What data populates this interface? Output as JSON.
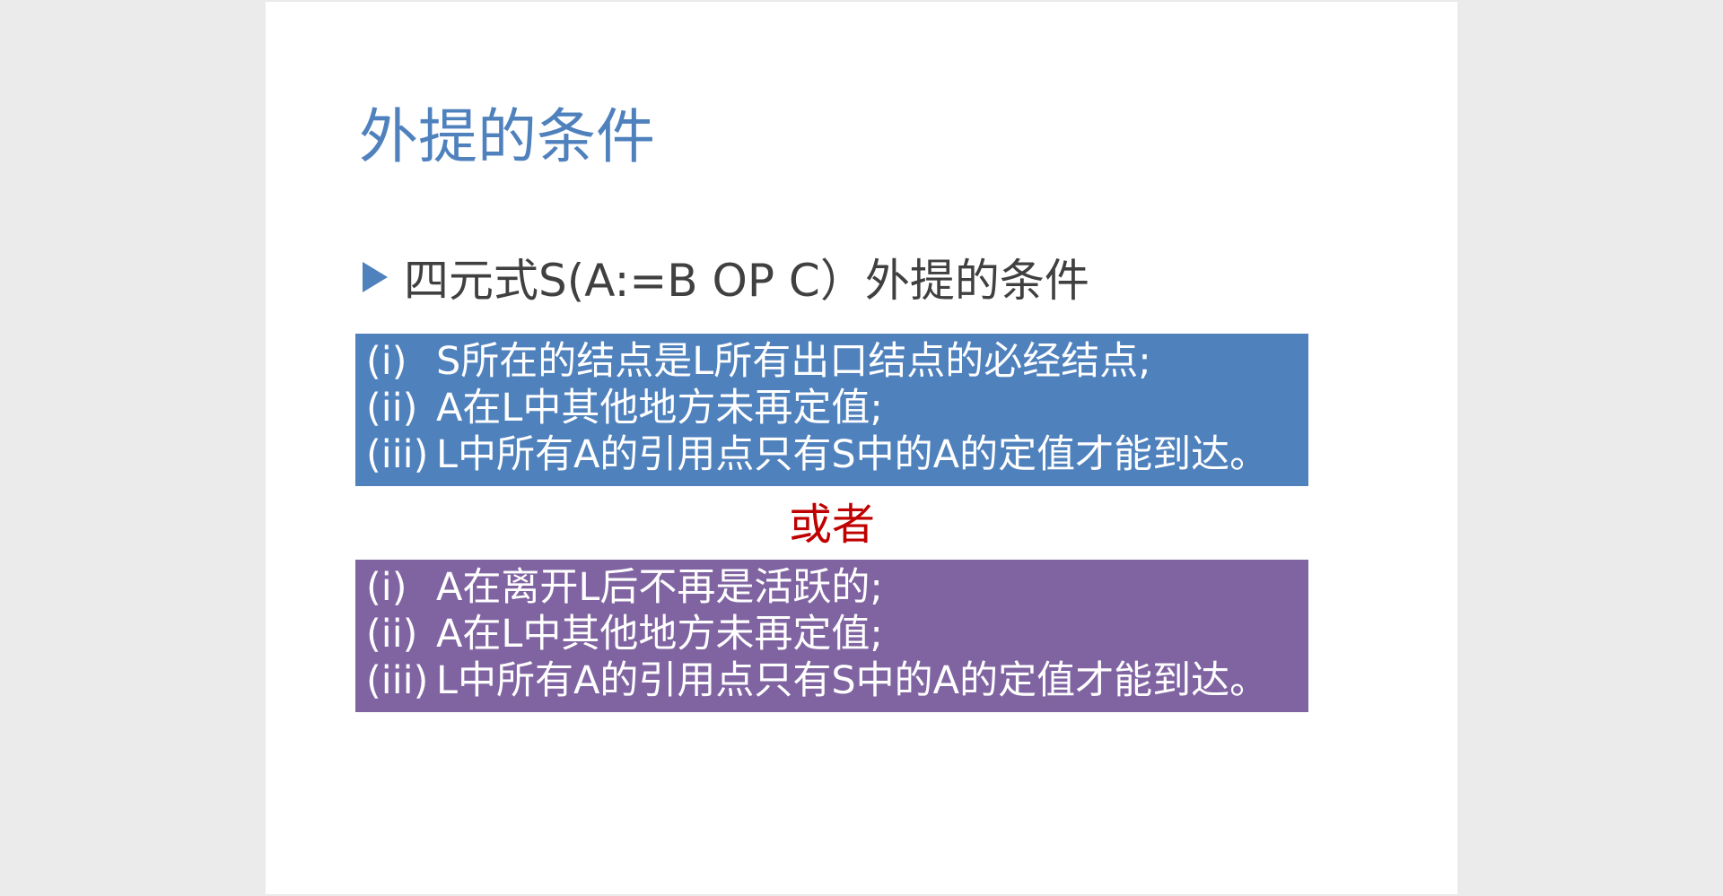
{
  "slide": {
    "title": "外提的条件",
    "bullet": {
      "marker": "triangle-bullet-icon",
      "text": "四元式S(A:=B OP C）外提的条件"
    },
    "condition_set_1": [
      {
        "num": "(i)",
        "text": "S所在的结点是L所有出口结点的必经结点;"
      },
      {
        "num": "(ii)",
        "text": "A在L中其他地方未再定值;"
      },
      {
        "num": "(iii)",
        "text": "L中所有A的引用点只有S中的A的定值才能到达。"
      }
    ],
    "or_label": "或者",
    "condition_set_2": [
      {
        "num": "(i)",
        "text": "A在离开L后不再是活跃的;"
      },
      {
        "num": "(ii)",
        "text": "A在L中其他地方未再定值;"
      },
      {
        "num": "(iii)",
        "text": "L中所有A的引用点只有S中的A的定值才能到达。"
      }
    ],
    "colors": {
      "title": "#4f81bd",
      "box_1": "#4f81bd",
      "box_2": "#8064a2",
      "or_label": "#c00000",
      "bullet_text": "#404040"
    }
  }
}
